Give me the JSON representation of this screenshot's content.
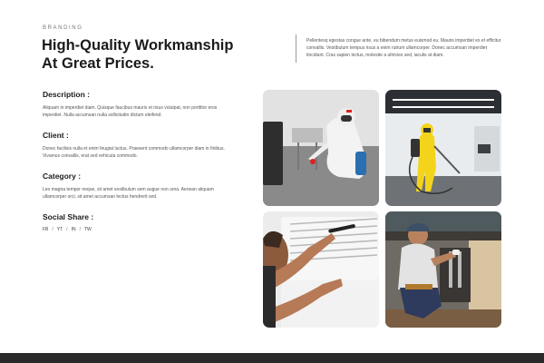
{
  "header": {
    "eyebrow": "BRANDING",
    "headline_line1": "High-Quality Workmanship",
    "headline_line2": "At Great Prices.",
    "intro": "Pellentesq egestas congue ante, eu bibendum metus euismod eu. Mauris imperdiet ex et efficitur convallis. Vestibulum tempus risus a enim rutrum ullamcorper. Donec accumsan imperdiet tincidunt. Cras sapien lectus, molestie a ultricies sed, iaculis at diam."
  },
  "details": {
    "description_title": "Description :",
    "description_text": "Aliquam in imperdiet diam. Quisque faucibus mauris et risus volutpat, non porttitor eros imperdiet. Nulla accumsan nulla sollicitudin dictum eleifend.",
    "client_title": "Client :",
    "client_text": "Donec facilisis nulla et enim feugiat luctus. Praesent commodo ullamcorper diam in finibus. Vivamus convallis, erat sed vehicula commodo.",
    "category_title": "Category :",
    "category_text": "Leo magna tempor neque, sit amet vestibulum sem augue non urna. Aenean aliquam ullamcorper orci, sit amet accumsan lectus hendrerit sed.",
    "social_title": "Social Share :",
    "social_links": [
      "FB",
      "YT",
      "IN",
      "TW"
    ],
    "social_separator": "/"
  },
  "gallery": {
    "photos": [
      {
        "icon": "pest-control-worker-white-suit-photo"
      },
      {
        "icon": "pest-control-worker-yellow-suit-photo"
      },
      {
        "icon": "ac-repair-technician-photo"
      },
      {
        "icon": "plumber-under-sink-photo"
      }
    ]
  },
  "colors": {
    "heading": "#1b1b1b",
    "body_text": "#555555",
    "footer": "#2a2a2a"
  }
}
